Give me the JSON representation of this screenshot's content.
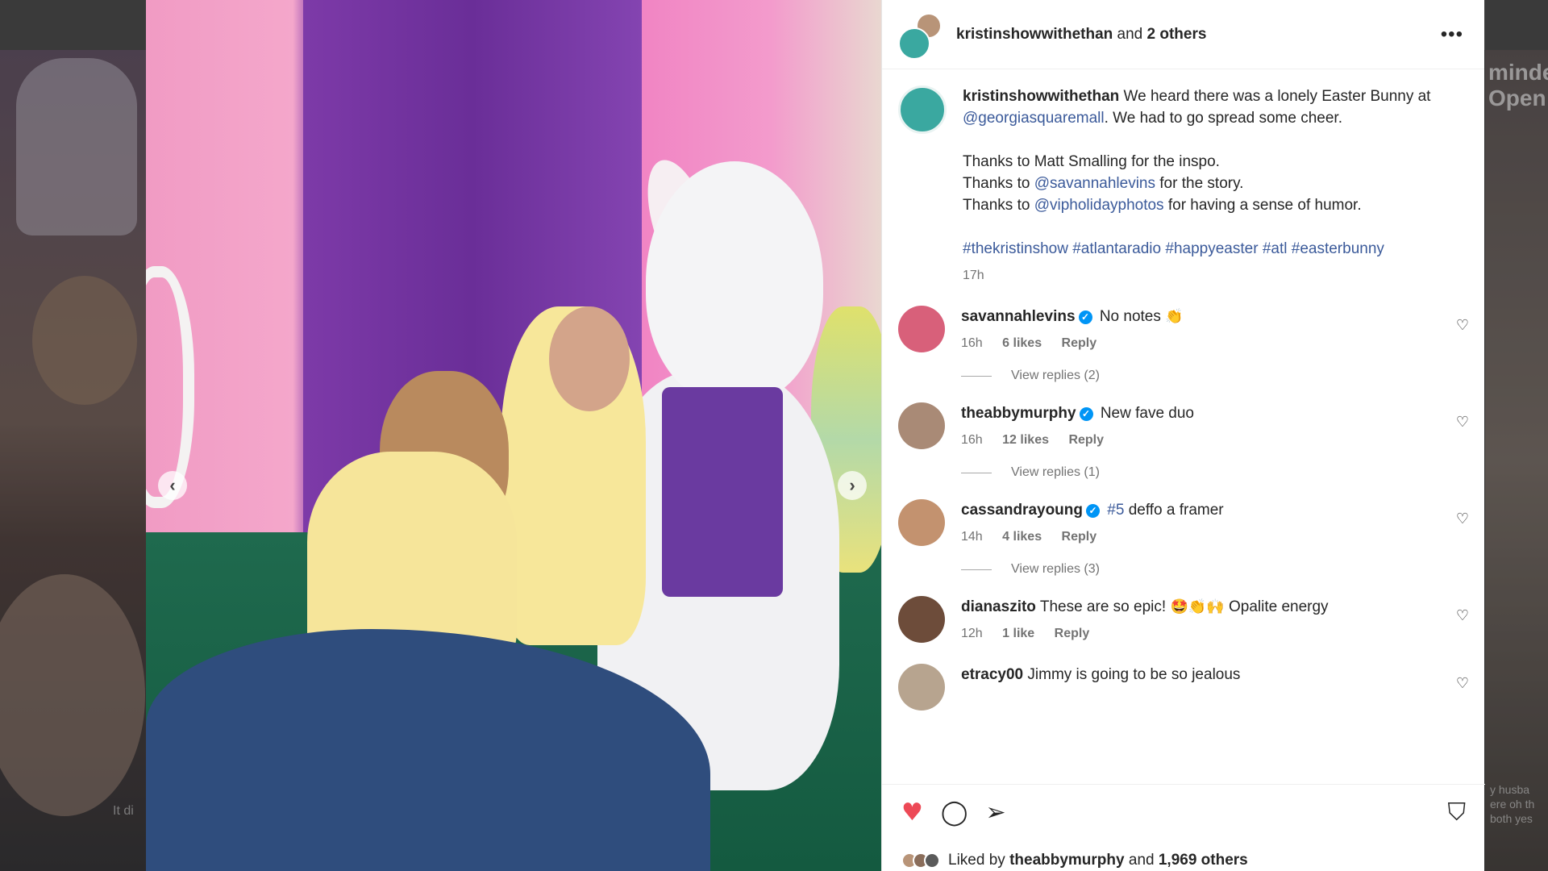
{
  "header": {
    "username": "kristinshowwithethan",
    "conjunction": "and",
    "others": "2 others",
    "more_icon": "more-horizontal-icon"
  },
  "caption": {
    "username": "kristinshowwithethan",
    "line1_pre": "We heard there was a lonely Easter Bunny at",
    "mention1": "@georgiasquaremall",
    "line1_post": ". We had to go spread some cheer.",
    "thanks1": "Thanks to Matt Smalling for the inspo.",
    "thanks2_pre": "Thanks to",
    "mention2": "@savannahlevins",
    "thanks2_post": "for the story.",
    "thanks3_pre": "Thanks to",
    "mention3": "@vipholidayphotos",
    "thanks3_post": "for having a sense of humor.",
    "hashtags": [
      "#thekristinshow",
      "#atlantaradio",
      "#happyeaster",
      "#atl",
      "#easterbunny"
    ],
    "time": "17h"
  },
  "comments": [
    {
      "username": "savannahlevins",
      "verified": true,
      "text": "No notes",
      "emoji": "👏",
      "time": "16h",
      "likes": "6 likes",
      "reply": "Reply",
      "view_replies": "View replies (2)"
    },
    {
      "username": "theabbymurphy",
      "verified": true,
      "text": "New fave duo",
      "time": "16h",
      "likes": "12 likes",
      "reply": "Reply",
      "view_replies": "View replies (1)"
    },
    {
      "username": "cassandrayoung",
      "verified": true,
      "tag": "#5",
      "text": "deffo a framer",
      "time": "14h",
      "likes": "4 likes",
      "reply": "Reply",
      "view_replies": "View replies (3)"
    },
    {
      "username": "dianaszito",
      "verified": false,
      "text": "These are so epic!",
      "emoji": "🤩👏🙌",
      "text2": "Opalite energy",
      "time": "12h",
      "likes": "1 like",
      "reply": "Reply"
    },
    {
      "username": "etracy00",
      "verified": false,
      "text": "Jimmy is going to be so jealous"
    }
  ],
  "likes_line": {
    "prefix": "Liked by",
    "user": "theabbymurphy",
    "and": "and",
    "others": "1,969 others"
  },
  "background_right": {
    "text1": "minde",
    "text2": "Open",
    "text3": "y husba",
    "text4": "ere oh th",
    "text5": "both yes"
  },
  "background_left": {
    "text1": "It di"
  },
  "colors": {
    "like_red": "#ed4956",
    "link_blue": "#3b5a9a",
    "verified_blue": "#0095f6"
  }
}
